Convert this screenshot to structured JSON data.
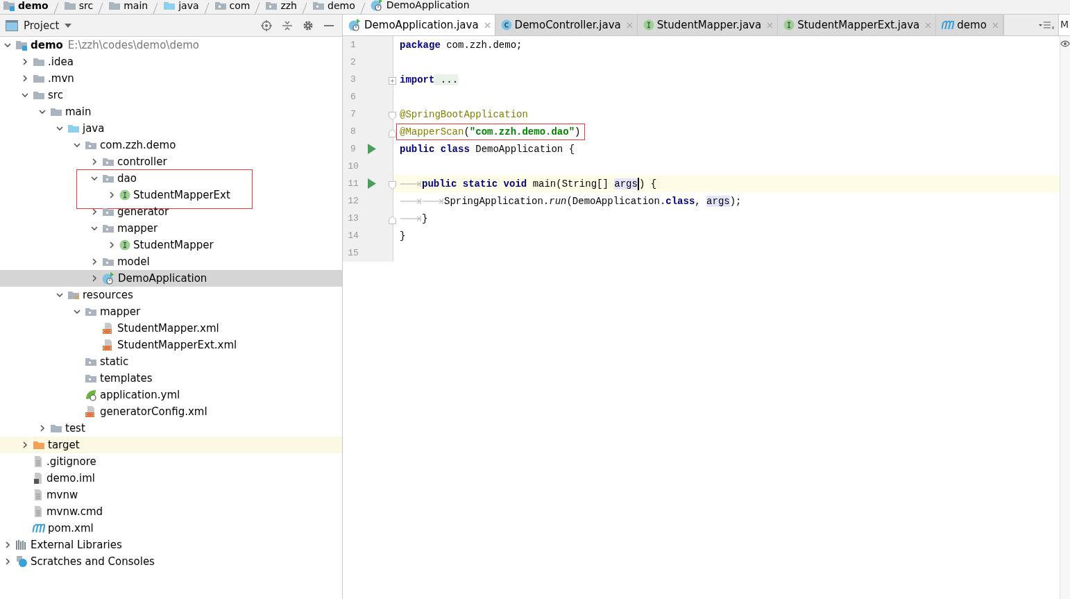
{
  "breadcrumbs": [
    {
      "label": "demo",
      "kind": "project"
    },
    {
      "label": "src",
      "kind": "folder"
    },
    {
      "label": "main",
      "kind": "folder"
    },
    {
      "label": "java",
      "kind": "source"
    },
    {
      "label": "com",
      "kind": "package"
    },
    {
      "label": "zzh",
      "kind": "package"
    },
    {
      "label": "demo",
      "kind": "package"
    },
    {
      "label": "DemoApplication",
      "kind": "app"
    }
  ],
  "project_panel": {
    "title": "Project",
    "tree": [
      {
        "label": "demo",
        "path": "E:\\zzh\\codes\\demo\\demo",
        "kind": "project",
        "expanded": true,
        "children": [
          {
            "label": ".idea",
            "kind": "folder",
            "expanded": false
          },
          {
            "label": ".mvn",
            "kind": "folder",
            "expanded": false
          },
          {
            "label": "src",
            "kind": "folder",
            "expanded": true,
            "children": [
              {
                "label": "main",
                "kind": "folder",
                "expanded": true,
                "children": [
                  {
                    "label": "java",
                    "kind": "source",
                    "expanded": true,
                    "children": [
                      {
                        "label": "com.zzh.demo",
                        "kind": "package",
                        "expanded": true,
                        "children": [
                          {
                            "label": "controller",
                            "kind": "package",
                            "expanded": false
                          },
                          {
                            "label": "dao",
                            "kind": "package",
                            "expanded": true,
                            "boxed": true,
                            "children": [
                              {
                                "label": "StudentMapperExt",
                                "kind": "interface",
                                "expanded": false
                              }
                            ]
                          },
                          {
                            "label": "generator",
                            "kind": "package",
                            "expanded": false
                          },
                          {
                            "label": "mapper",
                            "kind": "package",
                            "expanded": true,
                            "children": [
                              {
                                "label": "StudentMapper",
                                "kind": "interface",
                                "expanded": false
                              }
                            ]
                          },
                          {
                            "label": "model",
                            "kind": "package",
                            "expanded": false
                          },
                          {
                            "label": "DemoApplication",
                            "kind": "app",
                            "expanded": false,
                            "selected": true
                          }
                        ]
                      }
                    ]
                  },
                  {
                    "label": "resources",
                    "kind": "resources",
                    "expanded": true,
                    "children": [
                      {
                        "label": "mapper",
                        "kind": "package",
                        "expanded": true,
                        "children": [
                          {
                            "label": "StudentMapper.xml",
                            "kind": "xml"
                          },
                          {
                            "label": "StudentMapperExt.xml",
                            "kind": "xml"
                          }
                        ]
                      },
                      {
                        "label": "static",
                        "kind": "package"
                      },
                      {
                        "label": "templates",
                        "kind": "package"
                      },
                      {
                        "label": "application.yml",
                        "kind": "yml"
                      },
                      {
                        "label": "generatorConfig.xml",
                        "kind": "xml"
                      }
                    ]
                  }
                ]
              },
              {
                "label": "test",
                "kind": "folder",
                "expanded": false
              }
            ]
          },
          {
            "label": "target",
            "kind": "excluded",
            "expanded": false
          },
          {
            "label": ".gitignore",
            "kind": "file"
          },
          {
            "label": "demo.iml",
            "kind": "iml"
          },
          {
            "label": "mvnw",
            "kind": "file"
          },
          {
            "label": "mvnw.cmd",
            "kind": "file"
          },
          {
            "label": "pom.xml",
            "kind": "maven"
          }
        ]
      },
      {
        "label": "External Libraries",
        "kind": "libraries",
        "expanded": false
      },
      {
        "label": "Scratches and Consoles",
        "kind": "scratches",
        "expanded": false
      }
    ]
  },
  "editor_tabs": [
    {
      "label": "DemoApplication.java",
      "kind": "app",
      "selected": true
    },
    {
      "label": "DemoController.java",
      "kind": "class",
      "selected": false
    },
    {
      "label": "StudentMapper.java",
      "kind": "interface",
      "selected": false
    },
    {
      "label": "StudentMapperExt.java",
      "kind": "interface",
      "selected": false
    },
    {
      "label": "demo",
      "kind": "maven",
      "selected": false
    }
  ],
  "side_tab": "M",
  "code_lines": [
    {
      "number": "1",
      "tokens": [
        {
          "kind": "keyword",
          "text": "package"
        },
        {
          "kind": "plain",
          "text": " com.zzh.demo;"
        }
      ]
    },
    {
      "number": "2"
    },
    {
      "number": "3",
      "fold_start": true,
      "collapsed": true,
      "tokens": [
        {
          "kind": "keyword",
          "text": "import"
        },
        {
          "kind": "folded",
          "text": " ..."
        }
      ]
    },
    {
      "number": "6"
    },
    {
      "number": "7",
      "fold_start": true,
      "collapsed": false,
      "tokens": [
        {
          "kind": "annotation",
          "text": "@SpringBootApplication"
        }
      ]
    },
    {
      "number": "8",
      "fold_end": true,
      "boxed": true,
      "tokens": [
        {
          "kind": "annotation",
          "text": "@MapperScan"
        },
        {
          "kind": "plain",
          "text": "("
        },
        {
          "kind": "string",
          "text": "\"com.zzh.demo.dao\""
        },
        {
          "kind": "plain",
          "text": ")"
        }
      ]
    },
    {
      "number": "9",
      "run": true,
      "tokens": [
        {
          "kind": "keyword",
          "text": "public class"
        },
        {
          "kind": "plain",
          "text": " DemoApplication {"
        }
      ]
    },
    {
      "number": "10"
    },
    {
      "number": "11",
      "run": true,
      "fold_start": true,
      "collapsed": false,
      "current": true,
      "tokens": [
        {
          "kind": "tab"
        },
        {
          "kind": "keyword",
          "text": "public static void"
        },
        {
          "kind": "plain",
          "text": " main(String[] "
        },
        {
          "kind": "param",
          "text": "args"
        },
        {
          "kind": "caret"
        },
        {
          "kind": "plain",
          "text": ") {"
        }
      ]
    },
    {
      "number": "12",
      "tokens": [
        {
          "kind": "tab"
        },
        {
          "kind": "tab"
        },
        {
          "kind": "plain",
          "text": "SpringApplication."
        },
        {
          "kind": "method",
          "text": "run"
        },
        {
          "kind": "plain",
          "text": "(DemoApplication."
        },
        {
          "kind": "keyword",
          "text": "class"
        },
        {
          "kind": "plain",
          "text": ", "
        },
        {
          "kind": "param",
          "text": "args"
        },
        {
          "kind": "plain",
          "text": ");"
        }
      ]
    },
    {
      "number": "13",
      "fold_end": true,
      "tokens": [
        {
          "kind": "tab"
        },
        {
          "kind": "plain",
          "text": "}"
        }
      ]
    },
    {
      "number": "14",
      "tokens": [
        {
          "kind": "plain",
          "text": "}"
        }
      ]
    },
    {
      "number": "15"
    }
  ]
}
